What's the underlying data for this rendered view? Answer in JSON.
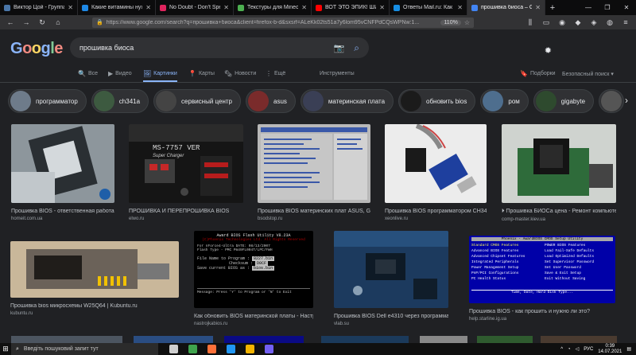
{
  "browser": {
    "tabs": [
      {
        "label": "Виктор Цой - Группа кр...",
        "fav_color": "#4a76a8",
        "active": false
      },
      {
        "label": "Какие витамины нужно...",
        "fav_color": "#1e88e5",
        "active": false
      },
      {
        "label": "No Doubt - Don't Speak...",
        "fav_color": "#e0245e",
        "active": false
      },
      {
        "label": "Текстуры для Minecraft...",
        "fav_color": "#4caf50",
        "active": false
      },
      {
        "label": "ВОТ ЭТО ЭПИК! ШИКАРН...",
        "fav_color": "#ff0000",
        "active": false
      },
      {
        "label": "Ответы Mail.ru: Как обн...",
        "fav_color": "#168de2",
        "active": false
      },
      {
        "label": "прошивка биоса – Goog...",
        "fav_color": "#4285f4",
        "active": true
      }
    ],
    "new_tab": "+",
    "url": "https://www.google.com/search?q=прошивка+биоса&client=firefox-b-d&sxsrf=ALeKk02ts51a7y6lom95vCNFPdCQsWPNw:1...",
    "zoom": "110%"
  },
  "google": {
    "logo": [
      {
        "ch": "G",
        "color": "#8ab4f8"
      },
      {
        "ch": "o",
        "color": "#f28b82"
      },
      {
        "ch": "o",
        "color": "#fdd663"
      },
      {
        "ch": "g",
        "color": "#8ab4f8"
      },
      {
        "ch": "l",
        "color": "#81c995"
      },
      {
        "ch": "e",
        "color": "#f28b82"
      }
    ],
    "query": "прошивка биоса",
    "menu": [
      {
        "label": "Все",
        "icon": "🔍",
        "active": false
      },
      {
        "label": "Видео",
        "icon": "▶",
        "active": false
      },
      {
        "label": "Картинки",
        "icon": "🖼",
        "active": true
      },
      {
        "label": "Карты",
        "icon": "📍",
        "active": false
      },
      {
        "label": "Новости",
        "icon": "🗞",
        "active": false
      },
      {
        "label": "Ещё",
        "icon": "⋮",
        "active": false
      },
      {
        "label": "Инструменты",
        "icon": "",
        "active": false
      },
      {
        "label": "Подборки",
        "icon": "🔖",
        "active": false
      },
      {
        "label": "Безопасный поиск ▾",
        "icon": "",
        "active": false
      }
    ],
    "chips": [
      {
        "label": "программатор",
        "color": "#6e7b8a"
      },
      {
        "label": "ch341a",
        "color": "#3d5a40"
      },
      {
        "label": "сервисный центр",
        "color": "#444"
      },
      {
        "label": "asus",
        "color": "#7a2b2b"
      },
      {
        "label": "материнская плата",
        "color": "#3a3f55"
      },
      {
        "label": "обновить bios",
        "color": "#1b1b1b"
      },
      {
        "label": "ром",
        "color": "#4e6e8e"
      },
      {
        "label": "gigabyte",
        "color": "#2e4a2e"
      },
      {
        "label": "",
        "color": "#555"
      }
    ],
    "results_row1": [
      {
        "caption": "Прошивка BIOS - ответственная работа, ...",
        "source": "homeit.com.ua",
        "bg": "#9fa7ad"
      },
      {
        "caption": "ПРОШИВКА И ПЕРЕПРОШИВКА BIOS",
        "source": "elwo.ru",
        "bg": "#1a1a1a"
      },
      {
        "caption": "Прошивка BIOS материнских плат ASUS, GI...",
        "source": "bsodstop.ru",
        "bg": "#c9c9c9"
      },
      {
        "caption": "Прошивка BIOS программатором CH34...",
        "source": "xeonlive.ru",
        "bg": "#e9e9e9"
      },
      {
        "caption": "⏵ Прошивка БИОСа цена - Ремонт компьюте...",
        "source": "comp-master.kiev.ua",
        "bg": "#d4d4d4"
      }
    ],
    "results_row2": [
      {
        "caption": "Прошивка bios микросхемы W25Q64 | Kubuntu.ru",
        "source": "kubuntu.ru",
        "bg": "#c9b79a"
      },
      {
        "caption": "Как обновить BIOS материнской платы - Настрой...",
        "source": "nastrojkabios.ru",
        "bg": "#000000"
      },
      {
        "caption": "Прошивка BIOS Dell e4310 через программато...",
        "source": "vlab.su",
        "bg": "#1c3a5e"
      },
      {
        "caption": "Прошивка BIOS - как прошить и нужно ли это?",
        "source": "help.starline.ig.ua",
        "bg": "#0000a8"
      }
    ],
    "bios_screen": {
      "header": "Award BIOS Flash Utility V8.23A",
      "company": "(C)Phoenix Technologies Ltd. All Rights Reserved",
      "line1": "For nForce4-Ultra   DATE: 08/13/2007",
      "line2": "Flash Type - PMC Pm49FL004T/LPC/FWH",
      "field1_label": "File Name to Program :",
      "field1_value": "8227.bin",
      "field2_label": "Checksum :",
      "field2_value": "D0CF",
      "field3_label": "Save current BIOS as :",
      "field3_value": "bios.bin",
      "footer": "Message:  Press 'Y' to Program or 'N' to Exit"
    },
    "setup_screen": {
      "title": "Phoenix - AwardBIOS CMOS Setup Utility",
      "left": [
        "Standard CMOS Features",
        "Advanced BIOS Features",
        "Advanced Chipset Features",
        "Integrated Peripherals",
        "Power Management Setup",
        "PnP/PCI Configurations",
        "PC Health Status"
      ],
      "right": [
        "POWER BIOS Features",
        "Load Fail-Safe Defaults",
        "Load Optimized Defaults",
        "Set Supervisor Password",
        "Set User Password",
        "Save & Exit Setup",
        "Exit Without Saving"
      ],
      "footer": "Time, Date, Hard Disk Type..."
    },
    "board_label": "MS-7757 VER",
    "board_sub": "Super Charger"
  },
  "taskbar": {
    "search_placeholder": "Введіть пошуковий запит тут",
    "lang": "РУС",
    "time": "0:39",
    "date": "14.07.2021",
    "apps": [
      {
        "name": "task-view",
        "color": "#cfcfcf"
      },
      {
        "name": "app",
        "color": "#3fa34d"
      },
      {
        "name": "firefox",
        "color": "#ff7139"
      },
      {
        "name": "media",
        "color": "#2196f3"
      },
      {
        "name": "app",
        "color": "#f4b400"
      },
      {
        "name": "viber",
        "color": "#7360f2"
      }
    ]
  }
}
